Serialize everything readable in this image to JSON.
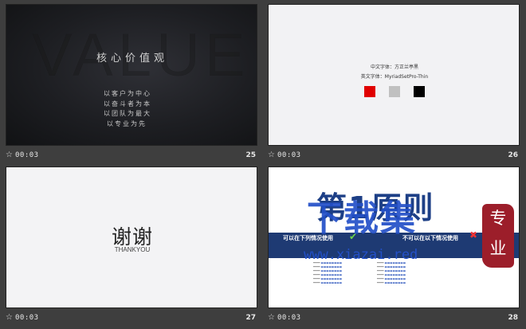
{
  "slides": [
    {
      "number": "25",
      "time": "00:03",
      "big_word": "VALUE",
      "title": "核心价值观",
      "lines": [
        "以客户为中心",
        "以奋斗者为本",
        "以团队为最大",
        "以专业为先"
      ]
    },
    {
      "number": "26",
      "time": "00:03",
      "font_cn": "中文字体：方正兰亭黑",
      "font_en": "英文字体：MyriadSetPro-Thin",
      "swatches": [
        "#e00000",
        "#c0c0c0",
        "#000000"
      ]
    },
    {
      "number": "27",
      "time": "00:03",
      "title": "谢谢",
      "subtitle": "THANKYOU"
    },
    {
      "number": "28",
      "time": "00:03",
      "heading": "第1原则",
      "left_label": "可以在下列情况使用",
      "right_label": "不可以在以下情况使用"
    }
  ],
  "watermark": {
    "title": "下载集",
    "url": "www.xiazai.red",
    "seal": [
      "专",
      "业"
    ]
  },
  "icons": {
    "play": "star-icon"
  }
}
